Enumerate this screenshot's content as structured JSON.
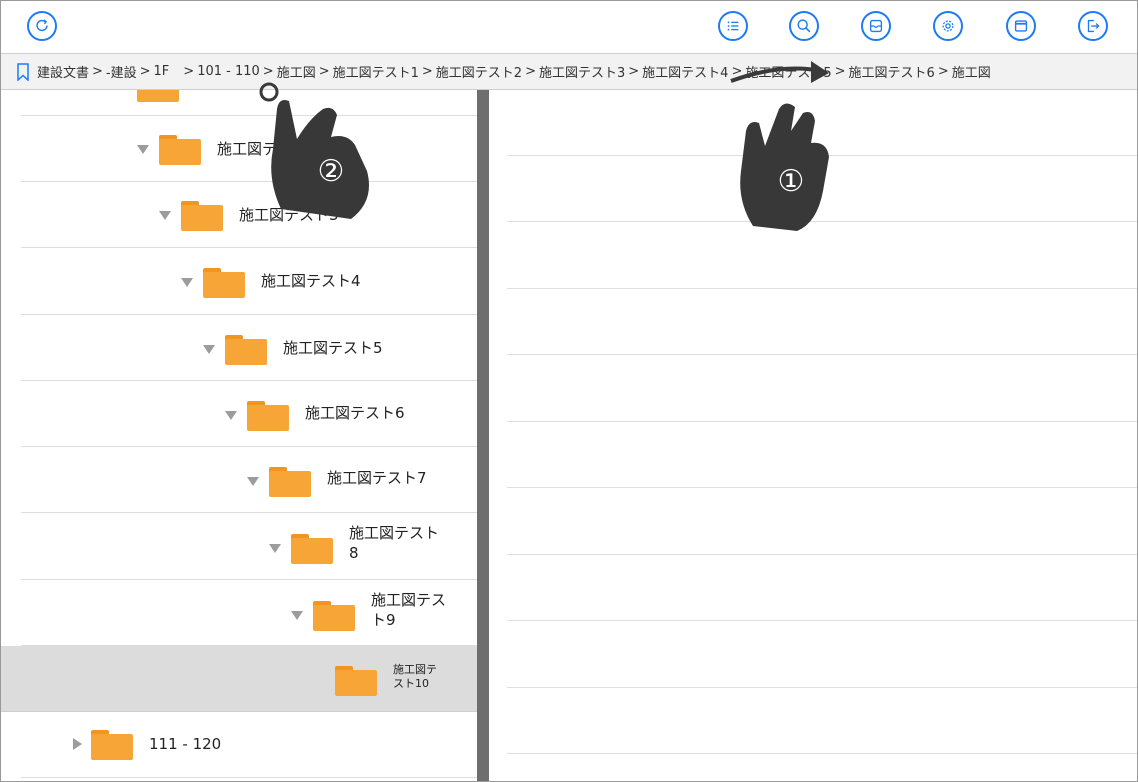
{
  "toolbar": {
    "refresh_icon": "refresh-icon",
    "buttons": [
      {
        "name": "list-icon"
      },
      {
        "name": "search-icon"
      },
      {
        "name": "inbox-icon"
      },
      {
        "name": "gear-icon"
      },
      {
        "name": "window-icon"
      },
      {
        "name": "logout-icon"
      }
    ],
    "accent": "#1e7bf5"
  },
  "breadcrumb": {
    "items": [
      "建設文書",
      "-建設",
      "1F",
      "101 - 110",
      "施工図",
      "施工図テスト1",
      "施工図テスト2",
      "施工図テスト3",
      "施工図テスト4",
      "施工図テスト5",
      "施工図テスト6",
      "施工図"
    ]
  },
  "tree": {
    "rows": [
      {
        "label": ""
      },
      {
        "label": "施工図テスト2"
      },
      {
        "label": "施工図テスト3"
      },
      {
        "label": "施工図テスト4"
      },
      {
        "label": "施工図テスト5"
      },
      {
        "label": "施工図テスト6"
      },
      {
        "label": "施工図テスト7"
      },
      {
        "label_line1": "施工図テスト",
        "label_line2": "8"
      },
      {
        "label_line1": "施工図テス",
        "label_line2": "ト9"
      },
      {
        "label_line1": "施工図テ",
        "label_line2": "スト10"
      },
      {
        "label": "111 - 120"
      }
    ],
    "folder_color": "#f7a536",
    "selected_color": "#dcdcdc"
  },
  "gestures": {
    "first": "①",
    "second": "②"
  }
}
